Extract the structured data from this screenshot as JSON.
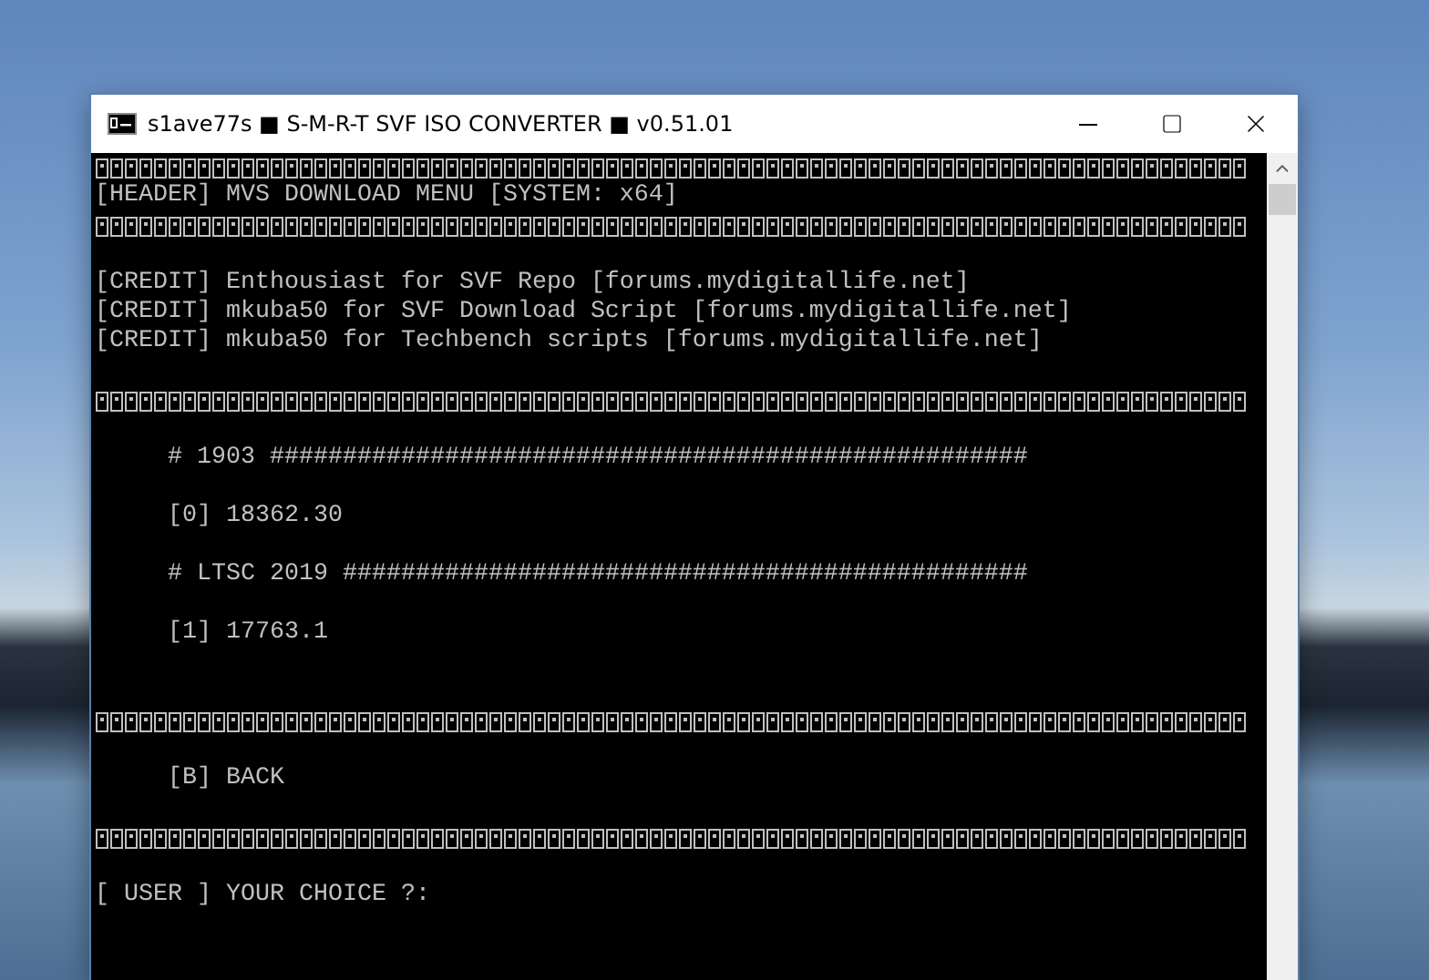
{
  "window": {
    "title": "s1ave77s ■ S-M-R-T SVF ISO CONVERTER ■ v0.51.01"
  },
  "console": {
    "lines": [
      {
        "kind": "separator"
      },
      {
        "kind": "text",
        "text": "[HEADER] MVS DOWNLOAD MENU [SYSTEM: x64]"
      },
      {
        "kind": "separator"
      },
      {
        "kind": "blank"
      },
      {
        "kind": "text",
        "text": "[CREDIT] Enthousiast for SVF Repo [forums.mydigitallife.net]"
      },
      {
        "kind": "text",
        "text": "[CREDIT] mkuba50 for SVF Download Script [forums.mydigitallife.net]"
      },
      {
        "kind": "text",
        "text": "[CREDIT] mkuba50 for Techbench scripts [forums.mydigitallife.net]"
      },
      {
        "kind": "blank"
      },
      {
        "kind": "separator"
      },
      {
        "kind": "blank"
      },
      {
        "kind": "indented",
        "text": "# 1903 ####################################################"
      },
      {
        "kind": "blank"
      },
      {
        "kind": "indented",
        "text": "[0] 18362.30"
      },
      {
        "kind": "blank"
      },
      {
        "kind": "indented",
        "text": "# LTSC 2019 ###############################################"
      },
      {
        "kind": "blank"
      },
      {
        "kind": "indented",
        "text": "[1] 17763.1"
      },
      {
        "kind": "blank"
      },
      {
        "kind": "blank"
      },
      {
        "kind": "separator"
      },
      {
        "kind": "blank"
      },
      {
        "kind": "indented",
        "text": "[B] BACK"
      },
      {
        "kind": "blank"
      },
      {
        "kind": "separator"
      },
      {
        "kind": "blank"
      },
      {
        "kind": "text",
        "text": "[ USER ] YOUR CHOICE ?:"
      }
    ]
  }
}
